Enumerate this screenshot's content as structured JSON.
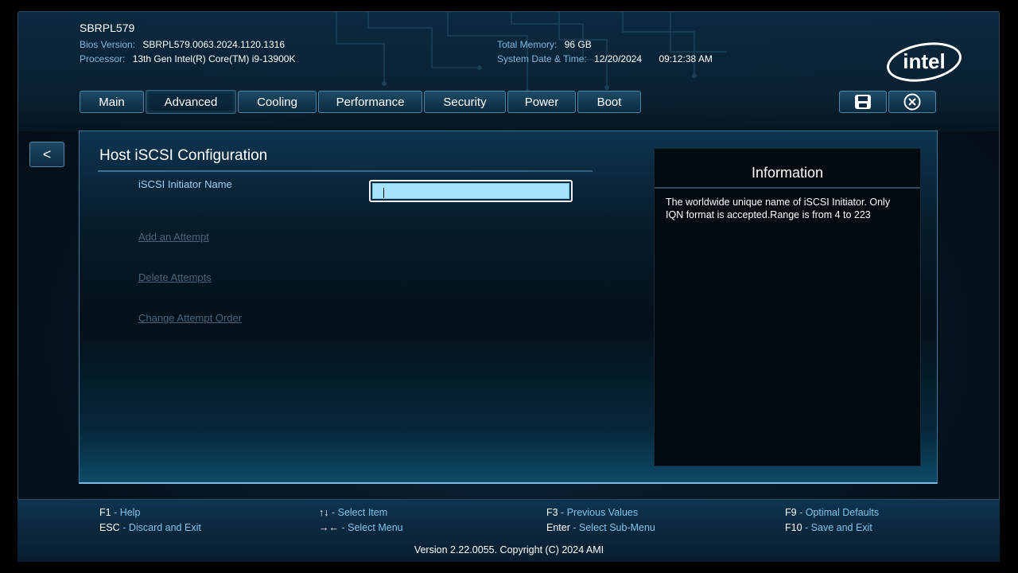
{
  "header": {
    "model": "SBRPL579",
    "bios_version_label": "Bios Version:",
    "bios_version_value": "SBRPL579.0063.2024.1120.1316",
    "processor_label": "Processor:",
    "processor_value": "13th Gen Intel(R) Core(TM) i9-13900K",
    "total_memory_label": "Total Memory:",
    "total_memory_value": "96 GB",
    "datetime_label": "System Date & Time:",
    "date_value": "12/20/2024",
    "time_value": "09:12:38 AM",
    "logo_text": "intel"
  },
  "tabs": [
    {
      "label": "Main"
    },
    {
      "label": "Advanced",
      "active": true
    },
    {
      "label": "Cooling"
    },
    {
      "label": "Performance"
    },
    {
      "label": "Security"
    },
    {
      "label": "Power"
    },
    {
      "label": "Boot"
    }
  ],
  "toolbar": {
    "save_icon": "save-icon",
    "exit_icon": "close-circle-icon"
  },
  "back_button": {
    "label": "<"
  },
  "page": {
    "title": "Host iSCSI Configuration",
    "initiator_name_label": "iSCSI Initiator Name",
    "initiator_name_value": "",
    "links": [
      {
        "label": "Add an Attempt"
      },
      {
        "label": "Delete Attempts"
      },
      {
        "label": "Change Attempt Order"
      }
    ]
  },
  "info": {
    "title": "Information",
    "text": "The worldwide unique name of iSCSI Initiator. Only IQN format is accepted.Range is from 4 to 223"
  },
  "footer": {
    "col1": [
      {
        "key": "F1",
        "sep": " - ",
        "desc": "Help"
      },
      {
        "key": "ESC",
        "sep": " - ",
        "desc": "Discard and Exit"
      }
    ],
    "col2": [
      {
        "key": "↑↓",
        "sep": " - ",
        "desc": "Select Item"
      },
      {
        "key": "→←",
        "sep": " - ",
        "desc": "Select Menu"
      }
    ],
    "col3": [
      {
        "key": "F3",
        "sep": " - ",
        "desc": "Previous Values"
      },
      {
        "key": "Enter",
        "sep": " - ",
        "desc": "Select Sub-Menu"
      }
    ],
    "col4": [
      {
        "key": "F9",
        "sep": " - ",
        "desc": "Optimal Defaults"
      },
      {
        "key": "F10",
        "sep": " - ",
        "desc": "Save and Exit"
      }
    ],
    "version": "Version 2.22.0055. Copyright (C) 2024 AMI"
  },
  "colors": {
    "accent": "#7fc3ec",
    "field_bg": "#a6e2fb",
    "disabled_link": "#48657a"
  }
}
